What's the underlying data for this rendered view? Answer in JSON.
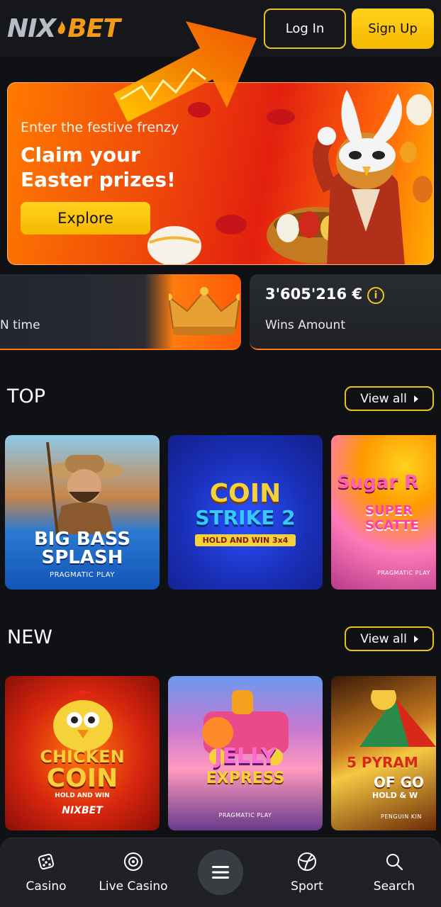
{
  "header": {
    "logo_text_part1": "NIX",
    "logo_text_part2": "BET",
    "login_label": "Log In",
    "signup_label": "Sign Up"
  },
  "banner": {
    "subtitle": "Enter the festive frenzy",
    "title_line1": "Claim your",
    "title_line2": "Easter prizes!",
    "cta_label": "Explore"
  },
  "stats": {
    "card1_label": "N time",
    "card2_value": "3'605'216 €",
    "card2_info": "i",
    "card2_label": "Wins Amount"
  },
  "sections": {
    "top": {
      "title": "TOP",
      "view_all": "View all",
      "games": [
        {
          "title_line1": "BIG BASS",
          "title_line2": "SPLASH",
          "provider": "PRAGMATIC PLAY"
        },
        {
          "title_line1": "COIN",
          "title_line2": "STRIKE 2",
          "tagline": "HOLD AND WIN 3x4"
        },
        {
          "title_line1": "Sugar R",
          "title_line2": "SUPER SCATTE",
          "provider": "PRAGMATIC PLAY"
        }
      ]
    },
    "new": {
      "title": "NEW",
      "view_all": "View all",
      "games": [
        {
          "title_line1": "CHICKEN",
          "title_line2": "COIN",
          "tagline": "HOLD AND WIN",
          "provider": "NIXBET"
        },
        {
          "title_line1": "JELLY",
          "title_line2": "EXPRESS",
          "provider": "PRAGMATIC PLAY"
        },
        {
          "title_line1": "5 PYRAM",
          "title_line2": "OF GO",
          "tagline": "HOLD & W",
          "provider": "PENGUIN KIN"
        }
      ]
    }
  },
  "bottom_nav": {
    "items": [
      {
        "label": "Casino",
        "icon": "dice-icon"
      },
      {
        "label": "Live Casino",
        "icon": "live-casino-icon"
      },
      {
        "label": "Sport",
        "icon": "sport-ball-icon"
      },
      {
        "label": "Search",
        "icon": "search-icon"
      }
    ],
    "menu_icon": "hamburger-menu-icon"
  },
  "colors": {
    "accent_yellow": "#f5c518",
    "brand_orange": "#f39a16",
    "background": "#0f1115"
  }
}
